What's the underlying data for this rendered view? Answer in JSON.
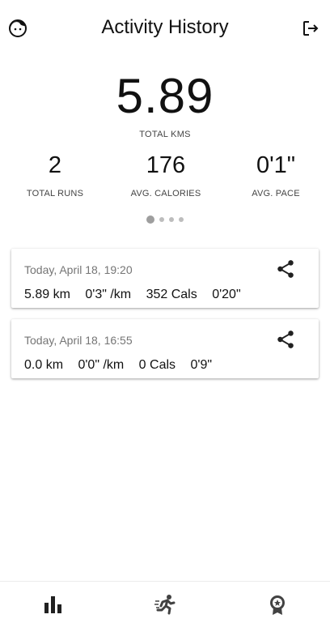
{
  "header": {
    "title": "Activity History",
    "avatar_icon": "face-icon",
    "logout_icon": "logout-icon"
  },
  "summary": {
    "total_kms_value": "5.89",
    "total_kms_label": "TOTAL KMS",
    "stats": [
      {
        "value": "2",
        "label": "TOTAL RUNS"
      },
      {
        "value": "176",
        "label": "AVG. CALORIES"
      },
      {
        "value": "0'1\"",
        "label": "AVG. PACE"
      }
    ],
    "pager": {
      "pages": 4,
      "active": 1
    }
  },
  "activities": [
    {
      "date": "Today, April 18, 19:20",
      "distance": "5.89 km",
      "pace": "0'3\" /km",
      "calories": "352 Cals",
      "duration": "0'20\""
    },
    {
      "date": "Today, April 18, 16:55",
      "distance": "0.0 km",
      "pace": "0'0\" /km",
      "calories": "0 Cals",
      "duration": "0'9\""
    }
  ],
  "bottom_nav": [
    {
      "icon": "bar-chart-icon"
    },
    {
      "icon": "running-man-icon"
    },
    {
      "icon": "award-badge-icon"
    }
  ],
  "colors": {
    "text": "#111111",
    "muted": "#757575",
    "icon": "#212121"
  }
}
